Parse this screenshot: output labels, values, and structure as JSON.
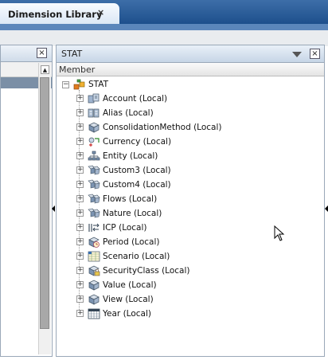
{
  "tab": {
    "title": "Dimension Library",
    "close_glyph": "×"
  },
  "left_panel": {
    "close_glyph": "×",
    "scroll_up_glyph": "▲"
  },
  "right_panel": {
    "title": "STAT",
    "close_glyph": "×",
    "column_header": "Member",
    "root": {
      "label": "STAT",
      "expander": "−"
    },
    "items": [
      {
        "label": "Account (Local)",
        "icon": "account-icon"
      },
      {
        "label": "Alias (Local)",
        "icon": "alias-icon"
      },
      {
        "label": "ConsolidationMethod (Local)",
        "icon": "generic-dimension-icon"
      },
      {
        "label": "Currency (Local)",
        "icon": "currency-icon"
      },
      {
        "label": "Entity (Local)",
        "icon": "entity-icon"
      },
      {
        "label": "Custom3 (Local)",
        "icon": "custom-dimension-icon"
      },
      {
        "label": "Custom4 (Local)",
        "icon": "custom-dimension-icon"
      },
      {
        "label": "Flows (Local)",
        "icon": "custom-dimension-icon"
      },
      {
        "label": "Nature (Local)",
        "icon": "custom-dimension-icon"
      },
      {
        "label": "ICP (Local)",
        "icon": "icp-icon"
      },
      {
        "label": "Period (Local)",
        "icon": "period-icon"
      },
      {
        "label": "Scenario (Local)",
        "icon": "scenario-icon"
      },
      {
        "label": "SecurityClass (Local)",
        "icon": "security-class-icon"
      },
      {
        "label": "Value (Local)",
        "icon": "generic-dimension-icon"
      },
      {
        "label": "View (Local)",
        "icon": "generic-dimension-icon"
      },
      {
        "label": "Year (Local)",
        "icon": "year-icon"
      }
    ],
    "expander_glyph": "+"
  }
}
